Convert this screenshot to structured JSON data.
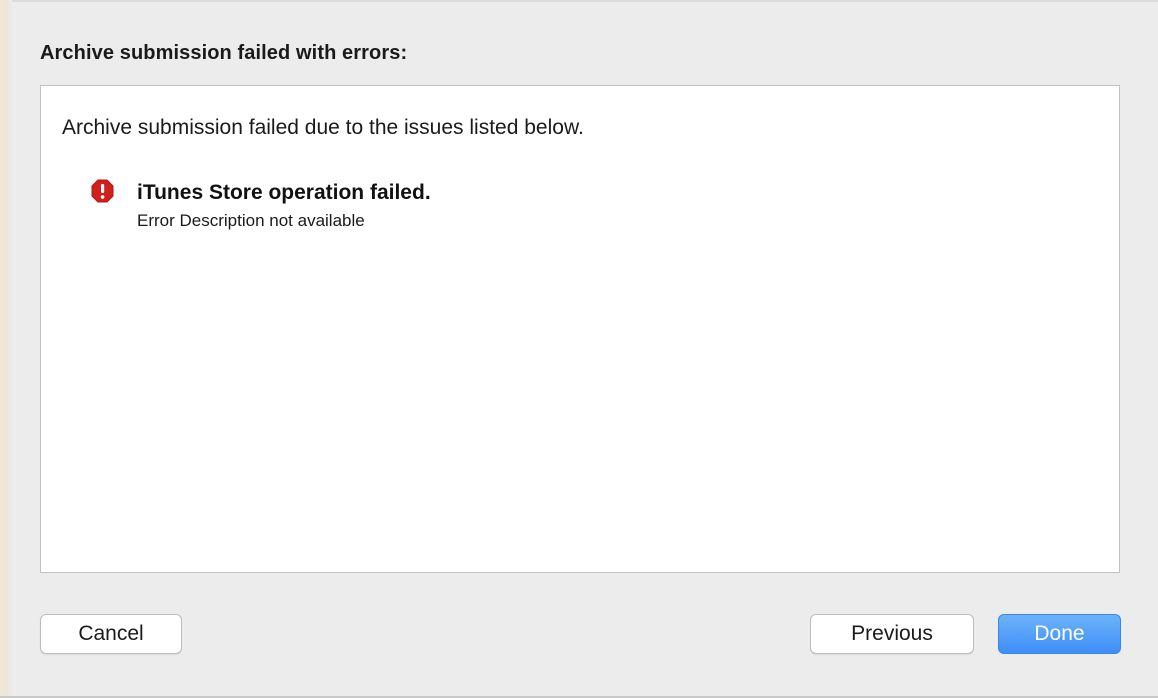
{
  "dialog": {
    "heading": "Archive submission failed with errors:",
    "intro": "Archive submission failed due to the issues listed below.",
    "issues": [
      {
        "icon": "error-octagon-icon",
        "title": "iTunes Store operation failed.",
        "description": "Error Description not available"
      }
    ]
  },
  "buttons": {
    "cancel": "Cancel",
    "previous": "Previous",
    "done": "Done"
  },
  "colors": {
    "error_icon": "#d0201d",
    "accent": "#3e8ef7"
  }
}
